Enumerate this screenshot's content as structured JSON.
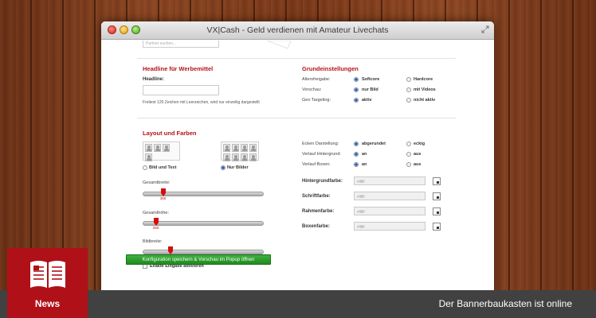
{
  "window": {
    "title": "VX|Cash - Geld verdienen mit Amateur Livechats"
  },
  "search": {
    "placeholder": "Partner suchen..."
  },
  "werbemittel": {
    "heading": "Headline für Werbemittel",
    "headline_label": "Headline:",
    "headline_value": "",
    "hint": "Freitext 120 Zeichen mit Leerzeichen, wird nur einzeilig dargestellt"
  },
  "grundeinstellungen": {
    "heading": "Grundeinstellungen",
    "rows": [
      {
        "label": "Altersfreigabe:",
        "opt1": "Softcore",
        "opt2": "Hardcore",
        "selected": 1
      },
      {
        "label": "Vorschau:",
        "opt1": "nur Bild",
        "opt2": "mit Videos",
        "selected": 1
      },
      {
        "label": "Geo Targeting:",
        "opt1": "aktiv",
        "opt2": "nicht aktiv",
        "selected": 1
      }
    ]
  },
  "layout": {
    "heading": "Layout und Farben",
    "option_image_text": "Bild und Text",
    "option_images_only": "Nur Bilder",
    "selected_option": "Nur Bilder",
    "sliders": [
      {
        "label": "Gesamtbreite:",
        "value": "350",
        "fraction": 0.17
      },
      {
        "label": "Gesamthöhe:",
        "value": "250",
        "fraction": 0.11
      },
      {
        "label": "Bildbreite:",
        "value": "90",
        "fraction": 0.23
      }
    ],
    "exact_input_label": "Exakte Eingabe aktivieren"
  },
  "darstellung": {
    "rows": [
      {
        "label": "Ecken Darstellung:",
        "opt1": "abgerundet",
        "opt2": "eckig",
        "selected": 1
      },
      {
        "label": "Verlauf Hintergrund:",
        "opt1": "an",
        "opt2": "aus",
        "selected": 1
      },
      {
        "label": "Verlauf Boxen:",
        "opt1": "an",
        "opt2": "aus",
        "selected": 1
      }
    ]
  },
  "colors": [
    {
      "label": "Hintergrundfarbe:",
      "value": "#ffffff"
    },
    {
      "label": "Schriftfarbe:",
      "value": "#ffffff"
    },
    {
      "label": "Rahmenfarbe:",
      "value": "#ffffff"
    },
    {
      "label": "Boxenfarbe:",
      "value": "#ffffff"
    }
  ],
  "actions": {
    "save_label": "Konfiguration speichern & Vorschau im Popup öffnen"
  },
  "news": {
    "badge_label": "News",
    "caption": "Der Bannerbaukasten ist online"
  },
  "theme": {
    "accent_red": "#b4131b",
    "button_green": "#2a9d2a",
    "bar_gray": "#414141"
  }
}
